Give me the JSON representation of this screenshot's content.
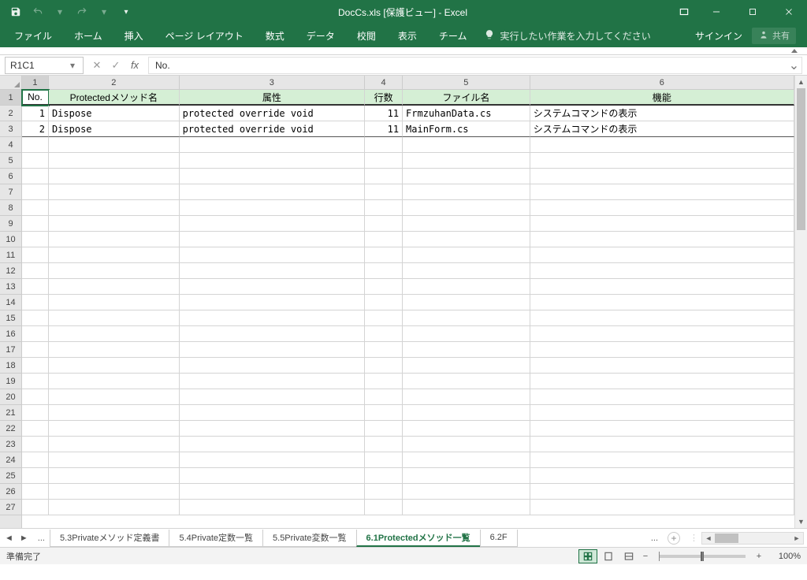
{
  "titlebar": {
    "title": "DocCs.xls  [保護ビュー] - Excel"
  },
  "ribbon": {
    "tabs": [
      "ファイル",
      "ホーム",
      "挿入",
      "ページ レイアウト",
      "数式",
      "データ",
      "校閲",
      "表示",
      "チーム"
    ],
    "tellme": "実行したい作業を入力してください",
    "signin": "サインイン",
    "share": "共有"
  },
  "formulabar": {
    "namebox": "R1C1",
    "formula": "No."
  },
  "columns": {
    "labels": [
      "1",
      "2",
      "3",
      "4",
      "5",
      "6"
    ],
    "widths": [
      34,
      166,
      236,
      48,
      162,
      336
    ]
  },
  "rows": {
    "labels": [
      "1",
      "2",
      "3",
      "4",
      "5",
      "6",
      "7",
      "8",
      "9",
      "10",
      "11",
      "12",
      "13",
      "14",
      "15",
      "16",
      "17",
      "18",
      "19",
      "20",
      "21",
      "22",
      "23",
      "24",
      "25",
      "26",
      "27"
    ]
  },
  "table": {
    "headers": [
      "No.",
      "Protectedメソッド名",
      "属性",
      "行数",
      "ファイル名",
      "機能"
    ],
    "data": [
      [
        "1",
        "Dispose",
        "protected override void",
        "11",
        "FrmzuhanData.cs",
        "システムコマンドの表示"
      ],
      [
        "2",
        "Dispose",
        "protected override void",
        "11",
        "MainForm.cs",
        "システムコマンドの表示"
      ]
    ]
  },
  "sheets": {
    "tabs": [
      "5.3Privateメソッド定義書",
      "5.4Private定数一覧",
      "5.5Private変数一覧",
      "6.1Protectedメソッド一覧",
      "6.2F"
    ],
    "overflow": "...",
    "active": 3
  },
  "statusbar": {
    "ready": "準備完了",
    "zoom": "100%"
  }
}
